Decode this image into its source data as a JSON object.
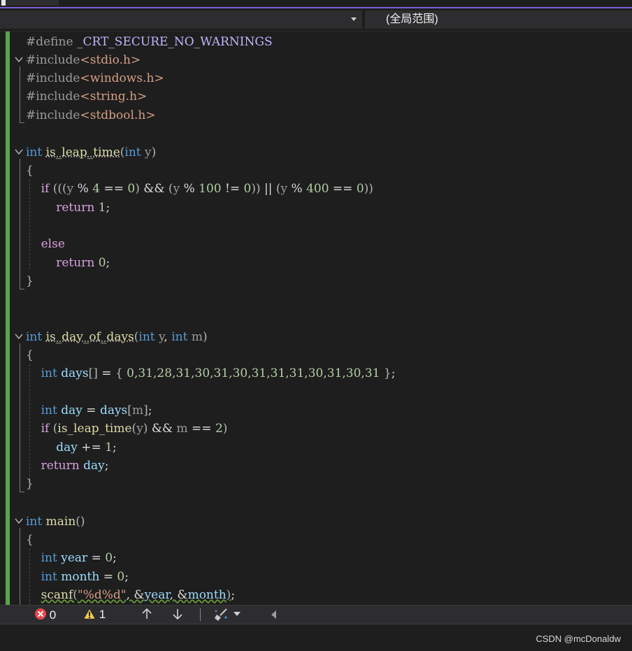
{
  "navigation": {
    "scope_dropdown_value": "(全局范围)"
  },
  "code": {
    "define_kw": "#define",
    "define_name": "_CRT_SECURE_NO_WARNINGS",
    "include_kw": "#include",
    "includes": [
      "<stdio.h>",
      "<windows.h>",
      "<string.h>",
      "<stdbool.h>"
    ],
    "f1_name": "is_leap_time",
    "f2_name": "is_day_of_days",
    "main_name": "main",
    "days_values": "0,31,28,31,30,31,30,31,31,31,30,31,30,31",
    "scanf_format": "\"%d%d\""
  },
  "status_bar": {
    "error_count": "0",
    "warning_count": "1"
  },
  "watermark": "CSDN @mcDonaldw",
  "colors": {
    "keyword": "#569cd6",
    "control": "#d8a0df",
    "function": "#dcdcaa",
    "number": "#b5cea8",
    "string": "#d69d85",
    "variable": "#9cdcfe",
    "change_bar": "#57a64a"
  },
  "icons": [
    "error-icon",
    "warning-icon",
    "arrow-up-icon",
    "arrow-down-icon",
    "cleanup-brush-icon",
    "chevron-down-icon",
    "scroll-left-icon",
    "fold-chevron-icon"
  ]
}
